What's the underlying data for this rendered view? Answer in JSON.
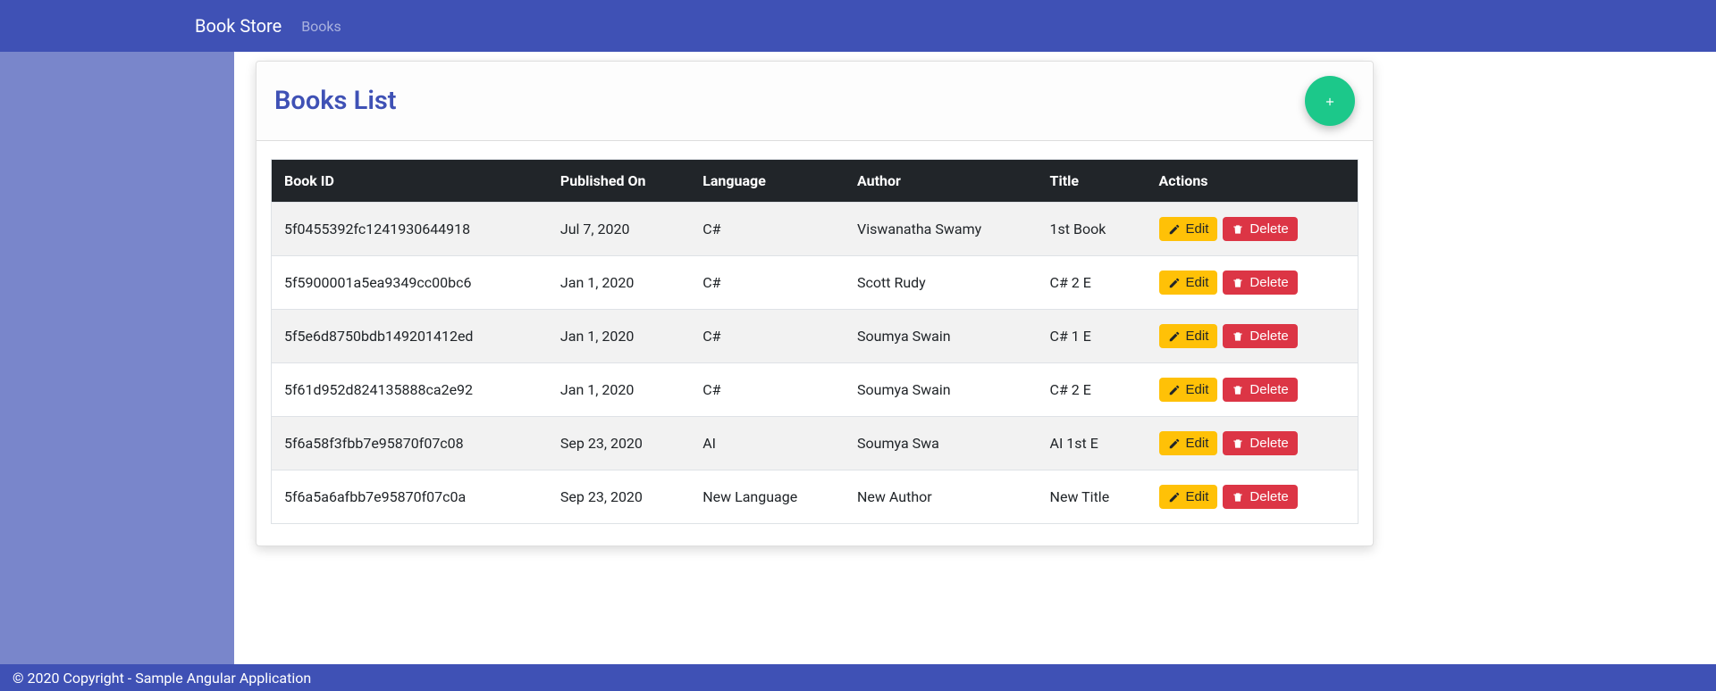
{
  "navbar": {
    "brand": "Book Store",
    "link_books": "Books"
  },
  "card": {
    "title": "Books List"
  },
  "table": {
    "headers": {
      "book_id": "Book ID",
      "published_on": "Published On",
      "language": "Language",
      "author": "Author",
      "title": "Title",
      "actions": "Actions"
    },
    "rows": [
      {
        "book_id": "5f0455392fc1241930644918",
        "published_on": "Jul 7, 2020",
        "language": "C#",
        "author": "Viswanatha Swamy",
        "title": "1st Book"
      },
      {
        "book_id": "5f5900001a5ea9349cc00bc6",
        "published_on": "Jan 1, 2020",
        "language": "C#",
        "author": "Scott Rudy",
        "title": "C# 2 E"
      },
      {
        "book_id": "5f5e6d8750bdb149201412ed",
        "published_on": "Jan 1, 2020",
        "language": "C#",
        "author": "Soumya Swain",
        "title": "C# 1 E"
      },
      {
        "book_id": "5f61d952d824135888ca2e92",
        "published_on": "Jan 1, 2020",
        "language": "C#",
        "author": "Soumya Swain",
        "title": "C# 2 E"
      },
      {
        "book_id": "5f6a58f3fbb7e95870f07c08",
        "published_on": "Sep 23, 2020",
        "language": "AI",
        "author": "Soumya Swa",
        "title": "AI 1st E"
      },
      {
        "book_id": "5f6a5a6afbb7e95870f07c0a",
        "published_on": "Sep 23, 2020",
        "language": "New Language",
        "author": "New Author",
        "title": "New Title"
      }
    ]
  },
  "buttons": {
    "edit": "Edit",
    "delete": "Delete"
  },
  "footer": {
    "text": "© 2020 Copyright - Sample Angular Application"
  }
}
